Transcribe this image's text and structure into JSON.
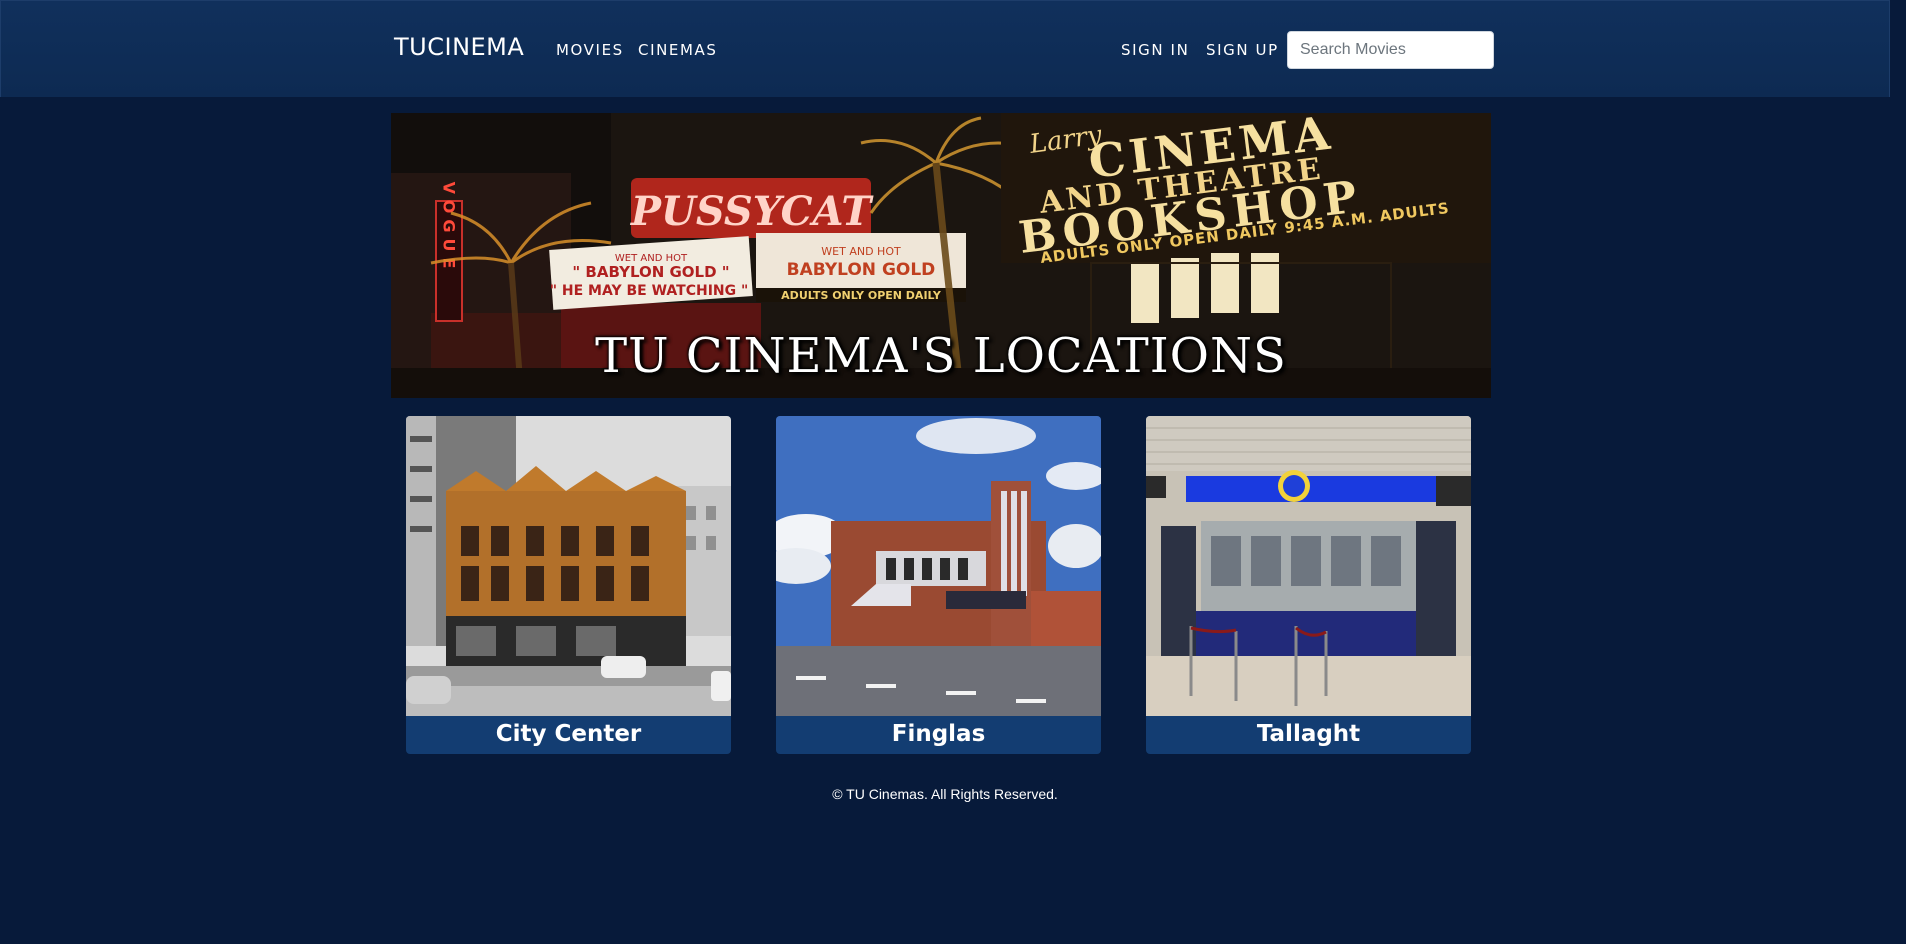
{
  "navbar": {
    "brand": "TUCINEMA",
    "links": [
      "MOVIES",
      "CINEMAS"
    ],
    "auth": [
      "SIGN IN",
      "SIGN UP"
    ],
    "search_placeholder": "Search Movies",
    "search_value": ""
  },
  "hero": {
    "title": "TU CINEMA'S LOCATIONS",
    "image_text": {
      "marquee_top": "PUSSYCAT",
      "marquee_left": [
        "WET AND HOT",
        "\" BABYLON GOLD \"",
        "\" HE MAY BE WATCHING \""
      ],
      "marquee_right": [
        "WET AND HOT",
        "BABYLON GOLD"
      ],
      "marquee_strip": "ADULTS ONLY OPEN DAILY",
      "sign_larry": "Larry",
      "sign_cinema": "CINEMA",
      "sign_theatre": "AND THEATRE",
      "sign_bookshop": "BOOKSHOP",
      "sign_strip": "ADULTS ONLY OPEN DAILY 9:45 A.M. ADULTS",
      "vogue": "VOGUE"
    }
  },
  "locations": [
    {
      "name": "City Center",
      "image": "city-center-photo"
    },
    {
      "name": "Finglas",
      "image": "finglas-photo"
    },
    {
      "name": "Tallaght",
      "image": "tallaght-photo"
    }
  ],
  "footer": {
    "copyright": "© TU Cinemas. All Rights Reserved."
  },
  "colors": {
    "page_background": "#071a3a",
    "navbar_background": "#0f2d57",
    "card_label_background": "#133d72",
    "text": "#ffffff"
  }
}
